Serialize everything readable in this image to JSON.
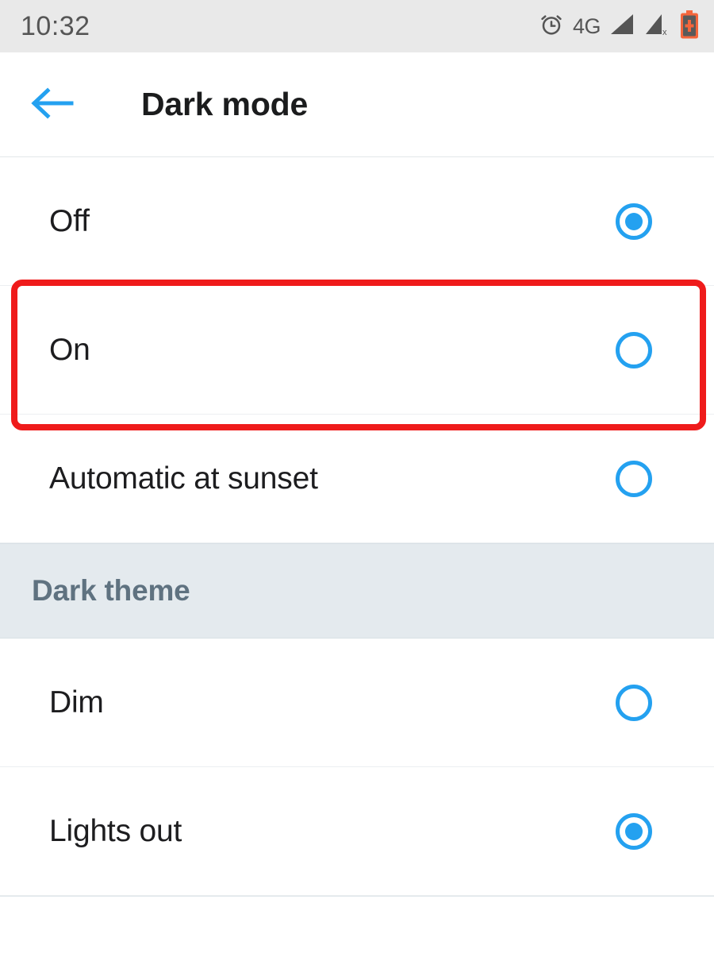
{
  "status_bar": {
    "time": "10:32",
    "network_label": "4G",
    "icons": [
      {
        "name": "alarm-clock-icon",
        "glyph": "alarm"
      },
      {
        "name": "network-type-label",
        "glyph": "4G"
      },
      {
        "name": "signal-bars-icon",
        "glyph": "signal-full"
      },
      {
        "name": "signal-bars-no-service-icon",
        "glyph": "signal-x"
      },
      {
        "name": "battery-charging-icon",
        "glyph": "battery-plus"
      }
    ],
    "background_color": "#e9e9e9",
    "text_color": "#555555",
    "battery_color": "#f4663c"
  },
  "app_bar": {
    "back_icon": "arrow-left-icon",
    "back_icon_color": "#24a1f0",
    "title": "Dark mode"
  },
  "theme": {
    "accent_color": "#24a1f0",
    "highlight_color": "#ef1b1b",
    "section_bg": "#e4eaee",
    "section_text": "#5f7280",
    "row_text": "#1d1d1f",
    "divider": "#eceff1"
  },
  "dark_mode_group": {
    "options": [
      {
        "label": "Off",
        "selected": true,
        "highlighted": false
      },
      {
        "label": "On",
        "selected": false,
        "highlighted": true
      },
      {
        "label": "Automatic at sunset",
        "selected": false,
        "highlighted": false
      }
    ]
  },
  "dark_theme_section": {
    "header": "Dark theme",
    "options": [
      {
        "label": "Dim",
        "selected": false
      },
      {
        "label": "Lights out",
        "selected": true
      }
    ]
  }
}
